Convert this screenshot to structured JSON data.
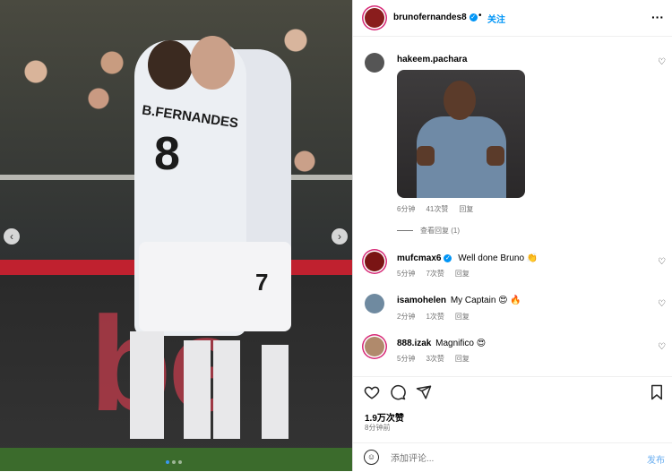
{
  "post": {
    "photo": {
      "shirt_name": "B.FERNANDES",
      "shirt_number": "8",
      "shorts_number": "7",
      "sponsor_text": "be",
      "prev_icon": "chevron-left-icon",
      "next_icon": "chevron-right-icon",
      "carousel_total": 3,
      "carousel_index": 1
    }
  },
  "header": {
    "username": "brunofernandes8",
    "verified": true,
    "separator": "•",
    "follow_label": "关注",
    "more_icon": "more-horizontal-icon",
    "more_label": "···"
  },
  "comments": [
    {
      "username": "hakeem.pachara",
      "text": "",
      "time": "6分钟",
      "likes": "41次赞",
      "reply": "回复",
      "has_image": true,
      "view_replies": "查看回复 (1)"
    },
    {
      "username": "mufcmax6",
      "verified": true,
      "text": "Well done Bruno 👏",
      "time": "5分钟",
      "likes": "7次赞",
      "reply": "回复"
    },
    {
      "username": "isamohelen",
      "text": "My Captain 😍 🔥",
      "time": "2分钟",
      "likes": "1次赞",
      "reply": "回复"
    },
    {
      "username": "888.izak",
      "text": "Magnifico 😍",
      "time": "5分钟",
      "likes": "3次赞",
      "reply": "回复"
    }
  ],
  "actions": {
    "like_icon": "heart-icon",
    "comment_icon": "comment-icon",
    "share_icon": "send-icon",
    "save_icon": "bookmark-icon"
  },
  "stats": {
    "likes": "1.9万次赞",
    "time": "8分钟前"
  },
  "comment_input": {
    "placeholder": "添加评论...",
    "post_label": "发布",
    "emoji_icon": "emoji-icon"
  },
  "colors": {
    "accent": "#0095f6",
    "muted": "#737373"
  }
}
